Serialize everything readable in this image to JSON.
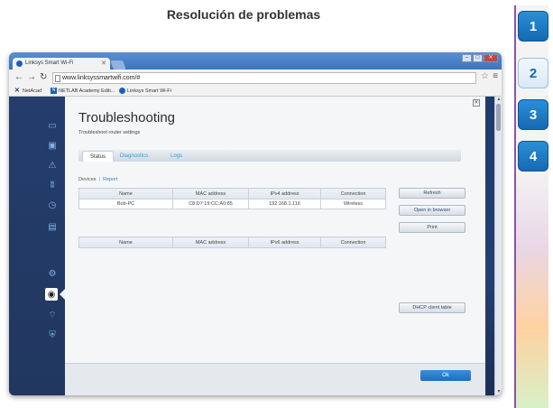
{
  "page_title": "Resolución de problemas",
  "steps": [
    {
      "label": "1",
      "active": false
    },
    {
      "label": "2",
      "active": true
    },
    {
      "label": "3",
      "active": false
    },
    {
      "label": "4",
      "active": false
    }
  ],
  "browser": {
    "tab_title": "Linksys Smart Wi-Fi",
    "url": "www.linksyssmartwifi.com/#",
    "bookmarks": [
      "NetAcad",
      "NETLAB Academy Editi...",
      "Linksys Smart Wi-Fi"
    ]
  },
  "dialog": {
    "title": "Troubleshooting",
    "subtitle": "Troubleshoot router settings",
    "tabs": [
      {
        "label": "Status",
        "active": true
      },
      {
        "label": "Diagnostics",
        "active": false
      },
      {
        "label": "Logs",
        "active": false
      }
    ],
    "subnav": {
      "devices": "Devices",
      "report": "Report"
    },
    "ipv4_table": {
      "headers": [
        "Name",
        "MAC address",
        "IPv4 address",
        "Connection"
      ],
      "rows": [
        [
          "Bob-PC",
          "C8:D7:19:CC:A0:85",
          "192.168.1.116",
          "Wireless"
        ]
      ]
    },
    "ipv6_table": {
      "headers": [
        "Name",
        "MAC address",
        "IPv6 address",
        "Connection"
      ]
    },
    "buttons": {
      "refresh": "Refresh",
      "open_in_browser": "Open in browser",
      "print": "Print",
      "dhcp": "DHCP client table",
      "ok": "Ok"
    }
  },
  "colors": {
    "accent": "#1e6fbf",
    "sidebar": "#21375f",
    "step_active_bg": "#e6f0fa"
  }
}
